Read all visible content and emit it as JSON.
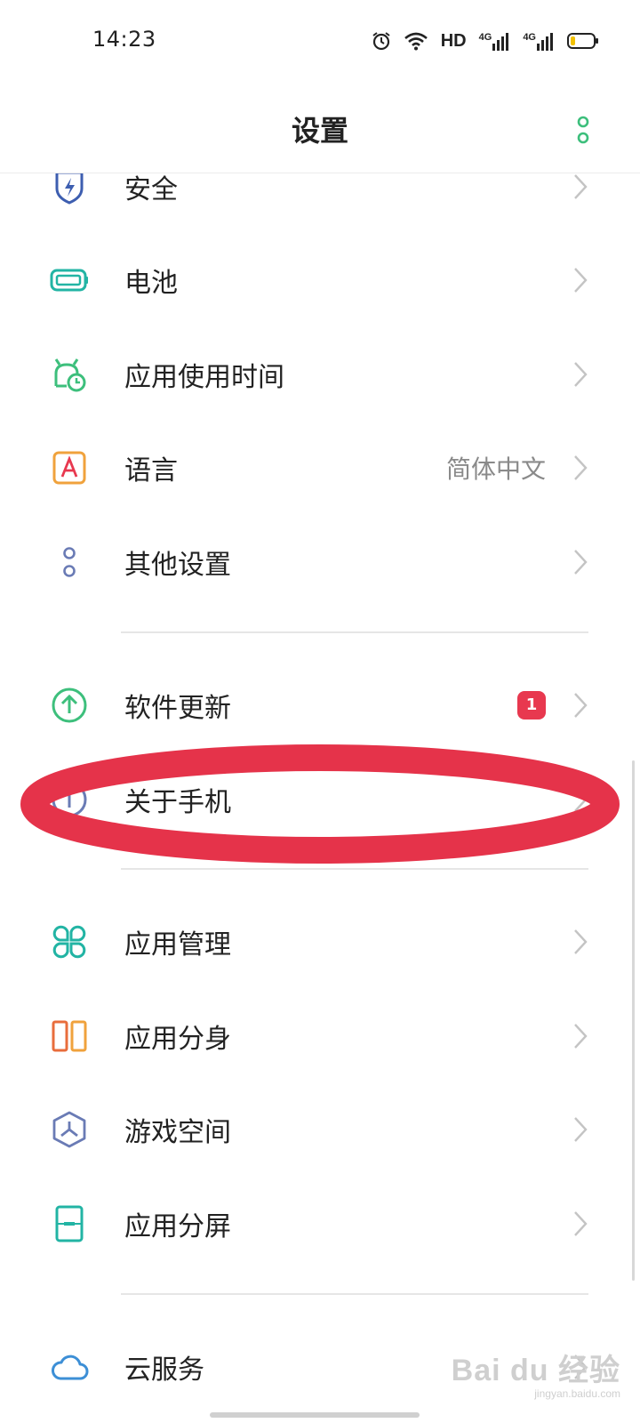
{
  "status_bar": {
    "time": "14:23",
    "hd_label": "HD",
    "network_1": "4G",
    "network_2": "4G",
    "battery_level": 0.2
  },
  "header": {
    "title": "设置"
  },
  "settings": {
    "security": {
      "label": "安全",
      "icon": "shield-bolt-icon"
    },
    "battery": {
      "label": "电池",
      "icon": "battery-icon"
    },
    "screen_time": {
      "label": "应用使用时间",
      "icon": "android-clock-icon"
    },
    "language": {
      "label": "语言",
      "value": "简体中文",
      "icon": "letter-a-icon"
    },
    "other": {
      "label": "其他设置",
      "icon": "two-dots-icon"
    },
    "software_update": {
      "label": "软件更新",
      "badge": "1",
      "icon": "arrow-up-circle-icon"
    },
    "about_phone": {
      "label": "关于手机",
      "icon": "info-circle-icon"
    },
    "app_management": {
      "label": "应用管理",
      "icon": "four-petals-icon"
    },
    "app_clone": {
      "label": "应用分身",
      "icon": "dual-app-icon"
    },
    "game_space": {
      "label": "游戏空间",
      "icon": "hexagon-tripod-icon"
    },
    "split_screen": {
      "label": "应用分屏",
      "icon": "split-screen-icon"
    },
    "cloud": {
      "label": "云服务",
      "icon": "cloud-icon"
    }
  },
  "watermark": {
    "brand": "Bai du 经验",
    "url": "jingyan.baidu.com"
  },
  "colors": {
    "accent_green": "#3dbf7c",
    "badge_red": "#e8384f",
    "annotation_red": "#e5334a",
    "security_blue": "#3d5eb0",
    "teal": "#22b4a4",
    "orange": "#f0a23c"
  }
}
